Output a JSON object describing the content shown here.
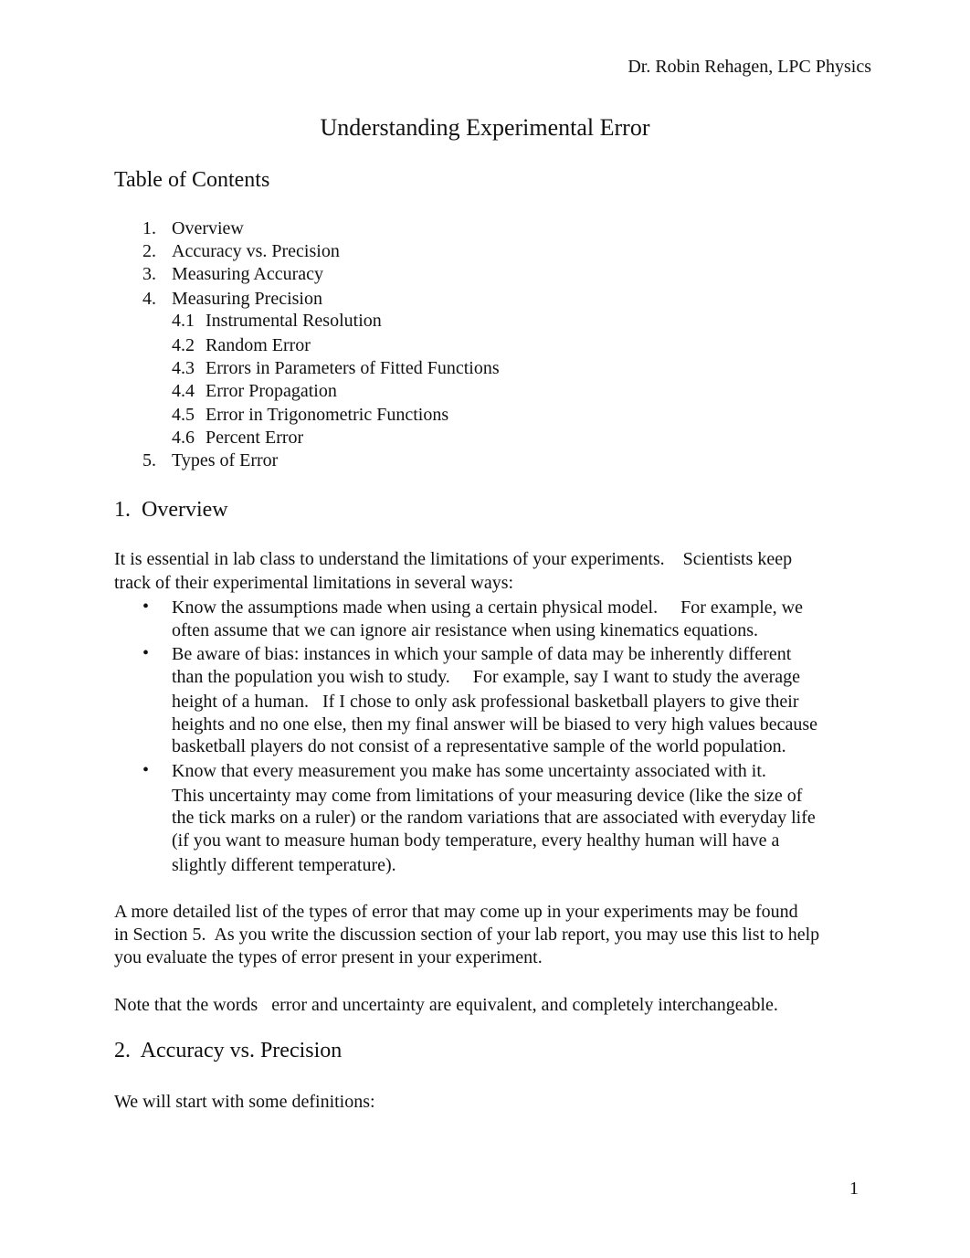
{
  "header": {
    "author_line": "Dr. Robin Rehagen, LPC Physics"
  },
  "title": "Understanding Experimental Error",
  "toc": {
    "heading": "Table of Contents",
    "items": [
      {
        "num": "1.",
        "label": "Overview"
      },
      {
        "num": "2.",
        "label": "Accuracy vs. Precision"
      },
      {
        "num": "3.",
        "label": "Measuring Accuracy"
      },
      {
        "num": "4.",
        "label": "Measuring Precision"
      },
      {
        "num": "4.1",
        "label": "Instrumental Resolution"
      },
      {
        "num": "4.2",
        "label": "Random Error"
      },
      {
        "num": "4.3",
        "label": "Errors in Parameters of Fitted Functions"
      },
      {
        "num": "4.4",
        "label": "Error Propagation"
      },
      {
        "num": "4.5",
        "label": "Error in Trigonometric Functions"
      },
      {
        "num": "4.6",
        "label": "Percent Error"
      },
      {
        "num": "5.",
        "label": "Types of Error"
      }
    ]
  },
  "section1": {
    "heading": "1.  Overview",
    "intro_lines": [
      "It is essential in lab class to understand the limitations of your experiments.    Scientists keep",
      "track of their experimental limitations in several ways:"
    ],
    "bullet_symbol": "•",
    "bullets": [
      {
        "lines": [
          "Know the assumptions made when using a certain physical model.     For example, we",
          "often assume that we can ignore air resistance when using kinematics equations."
        ]
      },
      {
        "lines": [
          "Be aware of bias: instances in which your sample of data may be inherently different",
          "than the population you wish to study.     For example, say I want to study the average",
          "height of a human.   If I chose to only ask professional basketball players to give their",
          "heights and no one else, then my final answer will be biased to very high values because",
          "basketball players do not consist of a representative sample of the world population."
        ]
      },
      {
        "lines": [
          "Know that every measurement you make has some uncertainty associated with it.",
          "This uncertainty may come from limitations of your measuring device (like the size of",
          "the tick marks on a ruler) or the random variations that are associated with everyday life",
          "(if you want to measure human body temperature, every healthy human will have a",
          "slightly different temperature)."
        ]
      }
    ],
    "para2_lines": [
      "A more detailed list of the types of error that may come up in your experiments may be found",
      "in Section 5.  As you write the discussion section of your lab report, you may use this list to help",
      "you evaluate the types of error present in your experiment."
    ],
    "note": "Note that the words   error and uncertainty are equivalent, and completely interchangeable."
  },
  "section2": {
    "heading": "2.  Accuracy vs. Precision",
    "intro": "We will start with some definitions:"
  },
  "footer": {
    "page_number": "1"
  }
}
